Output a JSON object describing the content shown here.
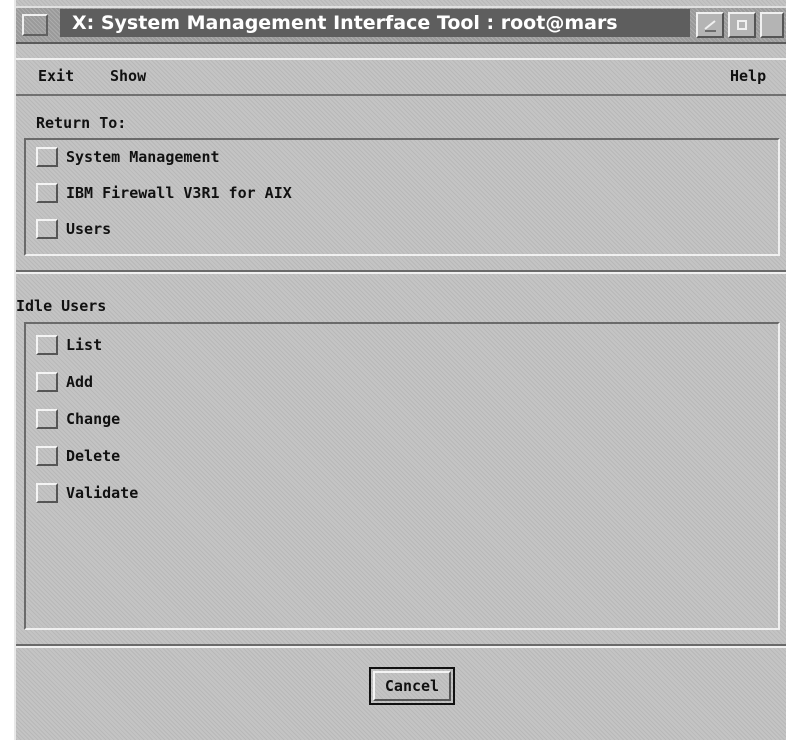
{
  "window": {
    "title": "X: System Management Interface Tool : root@mars"
  },
  "menubar": {
    "exit": "Exit",
    "show": "Show",
    "help": "Help"
  },
  "return_to": {
    "label": "Return To:",
    "items": [
      "System Management",
      "IBM Firewall V3R1 for AIX",
      "Users"
    ]
  },
  "idle_users": {
    "label": "Idle Users",
    "items": [
      "List",
      "Add",
      "Change",
      "Delete",
      "Validate"
    ]
  },
  "footer": {
    "cancel": "Cancel"
  },
  "icons": {
    "system_menu": "system-menu-icon",
    "minimize": "minimize-icon",
    "maximize": "maximize-icon"
  }
}
